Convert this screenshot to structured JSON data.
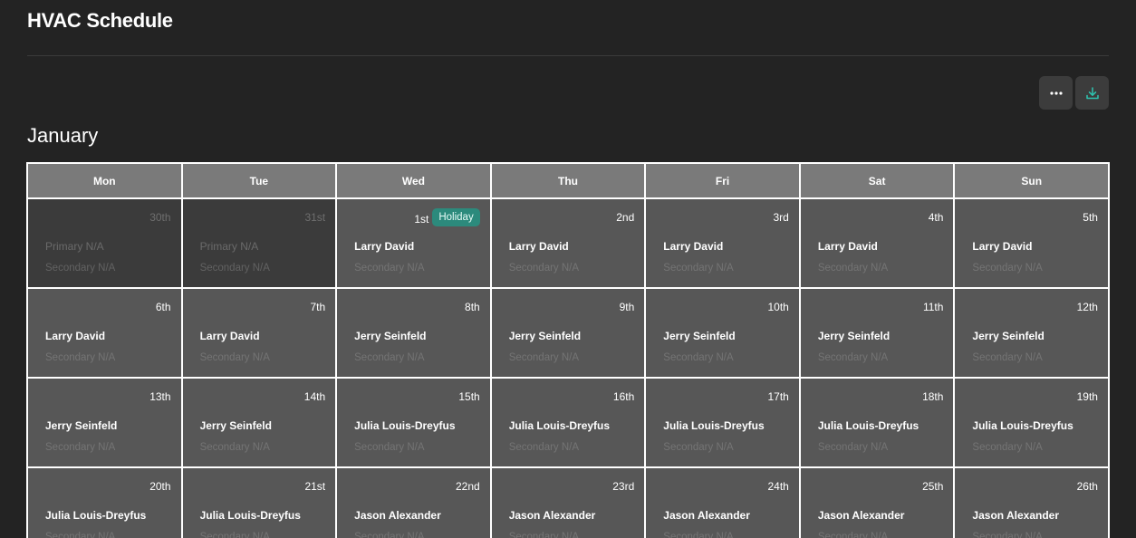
{
  "app": {
    "title": "HVAC Schedule"
  },
  "toolbar": {
    "more_icon": "more-horizontal-icon",
    "download_icon": "download-icon"
  },
  "colors": {
    "background": "#232323",
    "cell": "#575757",
    "header": "#7a7a7a",
    "holiday_badge": "#2c8a7c",
    "download_accent": "#2ec4b0"
  },
  "calendar": {
    "month": "January",
    "weekdays": [
      "Mon",
      "Tue",
      "Wed",
      "Thu",
      "Fri",
      "Sat",
      "Sun"
    ],
    "cells": [
      {
        "date": "30th",
        "primary": "Primary N/A",
        "secondary": "Secondary N/A",
        "other_month": true,
        "badge": ""
      },
      {
        "date": "31st",
        "primary": "Primary N/A",
        "secondary": "Secondary N/A",
        "other_month": true,
        "badge": ""
      },
      {
        "date": "1st",
        "primary": "Larry David",
        "secondary": "Secondary N/A",
        "other_month": false,
        "badge": "Holiday"
      },
      {
        "date": "2nd",
        "primary": "Larry David",
        "secondary": "Secondary N/A",
        "other_month": false,
        "badge": ""
      },
      {
        "date": "3rd",
        "primary": "Larry David",
        "secondary": "Secondary N/A",
        "other_month": false,
        "badge": ""
      },
      {
        "date": "4th",
        "primary": "Larry David",
        "secondary": "Secondary N/A",
        "other_month": false,
        "badge": ""
      },
      {
        "date": "5th",
        "primary": "Larry David",
        "secondary": "Secondary N/A",
        "other_month": false,
        "badge": ""
      },
      {
        "date": "6th",
        "primary": "Larry David",
        "secondary": "Secondary N/A",
        "other_month": false,
        "badge": ""
      },
      {
        "date": "7th",
        "primary": "Larry David",
        "secondary": "Secondary N/A",
        "other_month": false,
        "badge": ""
      },
      {
        "date": "8th",
        "primary": "Jerry Seinfeld",
        "secondary": "Secondary N/A",
        "other_month": false,
        "badge": ""
      },
      {
        "date": "9th",
        "primary": "Jerry Seinfeld",
        "secondary": "Secondary N/A",
        "other_month": false,
        "badge": ""
      },
      {
        "date": "10th",
        "primary": "Jerry Seinfeld",
        "secondary": "Secondary N/A",
        "other_month": false,
        "badge": ""
      },
      {
        "date": "11th",
        "primary": "Jerry Seinfeld",
        "secondary": "Secondary N/A",
        "other_month": false,
        "badge": ""
      },
      {
        "date": "12th",
        "primary": "Jerry Seinfeld",
        "secondary": "Secondary N/A",
        "other_month": false,
        "badge": ""
      },
      {
        "date": "13th",
        "primary": "Jerry Seinfeld",
        "secondary": "Secondary N/A",
        "other_month": false,
        "badge": ""
      },
      {
        "date": "14th",
        "primary": "Jerry Seinfeld",
        "secondary": "Secondary N/A",
        "other_month": false,
        "badge": ""
      },
      {
        "date": "15th",
        "primary": "Julia Louis-Dreyfus",
        "secondary": "Secondary N/A",
        "other_month": false,
        "badge": ""
      },
      {
        "date": "16th",
        "primary": "Julia Louis-Dreyfus",
        "secondary": "Secondary N/A",
        "other_month": false,
        "badge": ""
      },
      {
        "date": "17th",
        "primary": "Julia Louis-Dreyfus",
        "secondary": "Secondary N/A",
        "other_month": false,
        "badge": ""
      },
      {
        "date": "18th",
        "primary": "Julia Louis-Dreyfus",
        "secondary": "Secondary N/A",
        "other_month": false,
        "badge": ""
      },
      {
        "date": "19th",
        "primary": "Julia Louis-Dreyfus",
        "secondary": "Secondary N/A",
        "other_month": false,
        "badge": ""
      },
      {
        "date": "20th",
        "primary": "Julia Louis-Dreyfus",
        "secondary": "Secondary N/A",
        "other_month": false,
        "badge": ""
      },
      {
        "date": "21st",
        "primary": "Julia Louis-Dreyfus",
        "secondary": "Secondary N/A",
        "other_month": false,
        "badge": ""
      },
      {
        "date": "22nd",
        "primary": "Jason Alexander",
        "secondary": "Secondary N/A",
        "other_month": false,
        "badge": ""
      },
      {
        "date": "23rd",
        "primary": "Jason Alexander",
        "secondary": "Secondary N/A",
        "other_month": false,
        "badge": ""
      },
      {
        "date": "24th",
        "primary": "Jason Alexander",
        "secondary": "Secondary N/A",
        "other_month": false,
        "badge": ""
      },
      {
        "date": "25th",
        "primary": "Jason Alexander",
        "secondary": "Secondary N/A",
        "other_month": false,
        "badge": ""
      },
      {
        "date": "26th",
        "primary": "Jason Alexander",
        "secondary": "Secondary N/A",
        "other_month": false,
        "badge": ""
      }
    ]
  }
}
